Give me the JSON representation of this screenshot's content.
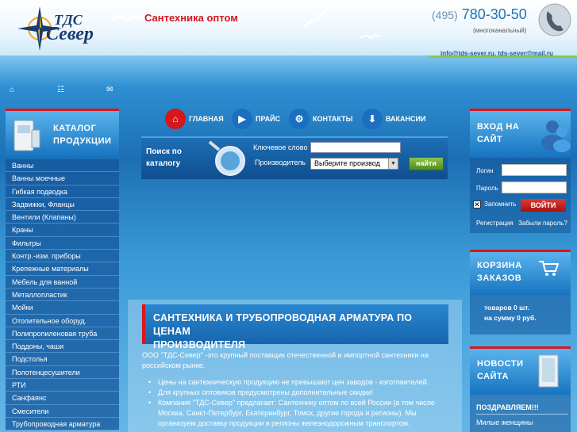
{
  "header": {
    "logo_line1": "ТДС",
    "logo_line2": "Север",
    "tagline": "Сантехника оптом",
    "phone_code": "(495)",
    "phone_number": "780-30-50",
    "phone_note": "(многоканальный)",
    "email": "info@tds-sever.ru, tds-sever@mail.ru"
  },
  "top_icons": [
    "home-icon",
    "sitemap-icon",
    "mail-icon"
  ],
  "nav": {
    "items": [
      {
        "label": "ГЛАВНАЯ",
        "icon": "home-icon",
        "color": "#d7161e"
      },
      {
        "label": "ПРАЙС",
        "icon": "play-icon",
        "color": "#1a6fc0"
      },
      {
        "label": "КОНТАКТЫ",
        "icon": "gear-icon",
        "color": "#1a6fc0"
      },
      {
        "label": "ВАКАНСИИ",
        "icon": "download-icon",
        "color": "#1a6fc0"
      }
    ]
  },
  "catalog": {
    "title_line1": "КАТАЛОГ",
    "title_line2": "ПРОДУКЦИИ",
    "items": [
      "Ванны",
      "Ванны моечные",
      "Гибкая подводка",
      "Задвижки, Фланцы",
      "Вентили (Клапаны)",
      "Краны",
      "Фильтры",
      "Контр.-изм. приборы",
      "Крепежные материалы",
      "Мебель для ванной",
      "Металлопластик",
      "Мойки",
      "Отопительное оборуд.",
      "Полипропиленовая труба",
      "Поддоны, чаши",
      "Подстолья",
      "Полотенцесушители",
      "РТИ",
      "Санфаянс",
      "Смесители",
      "Трубопроводная арматура"
    ]
  },
  "search": {
    "title_line1": "Поиск по",
    "title_line2": "каталогу",
    "keyword_label": "Ключевое слово",
    "keyword_value": "",
    "manufacturer_label": "Производитель",
    "manufacturer_selected": "Выберите производ",
    "find_button": "найти"
  },
  "main": {
    "title_line1": "САНТЕХНИКА И ТРУБОПРОВОДНАЯ АРМАТУРА ПО ЦЕНАМ",
    "title_line2": "ПРОИЗВОДИТЕЛЯ",
    "intro_line1": "ООО \"ТДС-Север\" -это крупный поставщик отечественной и импортной сантехники на",
    "intro_line2": "российском рынке.",
    "bullets": [
      "Цены на сантехническую продукцию не превышают цен заводов - изготовителей.",
      "Для крупных оптовиков предусмотрены дополнительные скидки!",
      "Компания \"ТДС-Север\" предлагает: Сантехнику оптом по всей России (в том числе Москва, Санкт-Петербург, Екатеринбург, Томск, другие города и регионы). Мы организуем доставку продукции в регионы железнодорожным транспортом."
    ]
  },
  "login": {
    "title_line1": "ВХОД НА",
    "title_line2": "САЙТ",
    "login_label": "Логин",
    "password_label": "Пароль",
    "remember_label": "Запомнить",
    "login_button": "ВОЙТИ",
    "register_link": "Регистрация",
    "forgot_link": "Забыли пароль?"
  },
  "cart": {
    "title_line1": "КОРЗИНА",
    "title_line2": "ЗАКАЗОВ",
    "items_line": "товаров 0 шт.",
    "sum_line": "на сумму 0 руб."
  },
  "news": {
    "title_line1": "НОВОСТИ",
    "title_line2": "САЙТА",
    "headline": "ПОЗДРАВЛЯЕМ!!!",
    "text": "Милые женщины"
  }
}
